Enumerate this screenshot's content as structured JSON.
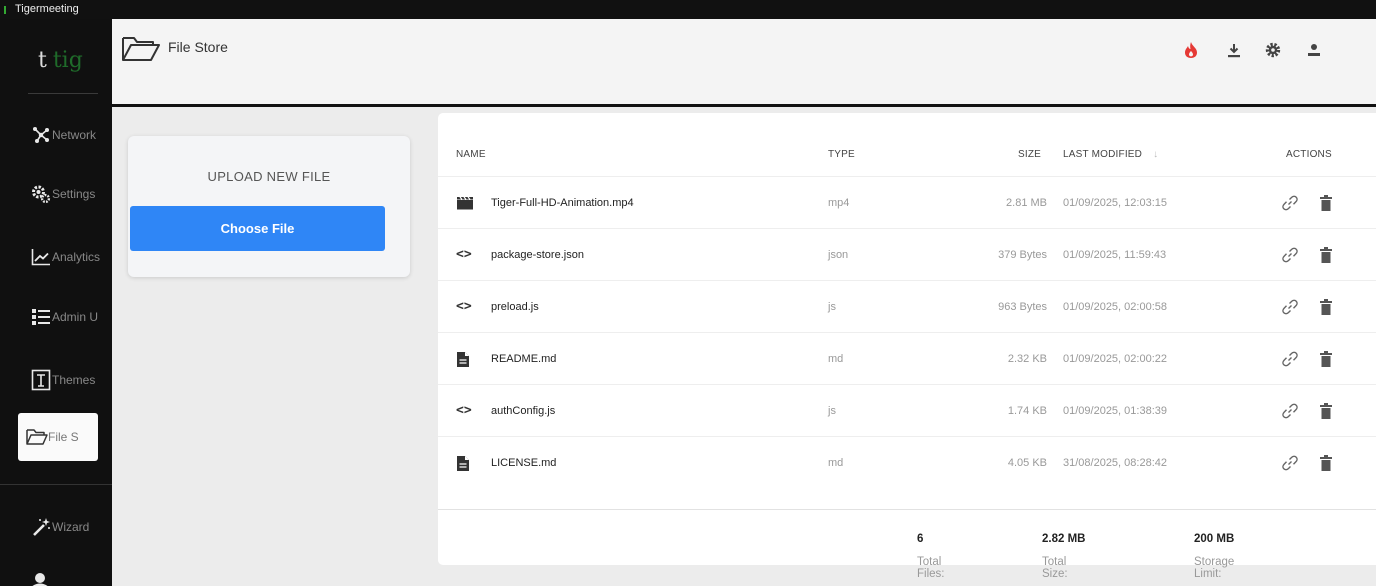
{
  "window": {
    "title": "Tigermeeting"
  },
  "sidebar": {
    "logo": {
      "prefix": "t",
      "accent": "tig"
    },
    "items": [
      {
        "label": "Network",
        "icon": "network-icon"
      },
      {
        "label": "Settings",
        "icon": "settings-icon"
      },
      {
        "label": "Analytics",
        "icon": "analytics-icon"
      },
      {
        "label": "Admin U",
        "icon": "admin-list-icon"
      },
      {
        "label": "Themes",
        "icon": "themes-icon"
      },
      {
        "label": "File S",
        "icon": "folder-icon",
        "active": true
      },
      {
        "label": "Wizard",
        "icon": "wizard-wand-icon"
      }
    ]
  },
  "header": {
    "title": "File Store",
    "icons": [
      "flame-icon",
      "download-icon",
      "gear-icon",
      "user-icon"
    ],
    "flame_color": "#e53935"
  },
  "upload": {
    "title": "UPLOAD NEW FILE",
    "button_label": "Choose File",
    "button_color": "#2f86f6"
  },
  "table": {
    "columns": {
      "name": "NAME",
      "type": "TYPE",
      "size": "SIZE",
      "modified": "LAST MODIFIED",
      "actions": "ACTIONS"
    },
    "sort_indicator": "↓",
    "rows": [
      {
        "icon": "video-icon",
        "name": "Tiger-Full-HD-Animation.mp4",
        "type": "mp4",
        "size": "2.81 MB",
        "modified": "01/09/2025, 12:03:15"
      },
      {
        "icon": "code-icon",
        "name": "package-store.json",
        "type": "json",
        "size": "379 Bytes",
        "modified": "01/09/2025, 11:59:43"
      },
      {
        "icon": "code-icon",
        "name": "preload.js",
        "type": "js",
        "size": "963 Bytes",
        "modified": "01/09/2025, 02:00:58"
      },
      {
        "icon": "document-icon",
        "name": "README.md",
        "type": "md",
        "size": "2.32 KB",
        "modified": "01/09/2025, 02:00:22"
      },
      {
        "icon": "code-icon",
        "name": "authConfig.js",
        "type": "js",
        "size": "1.74 KB",
        "modified": "01/09/2025, 01:38:39"
      },
      {
        "icon": "document-icon",
        "name": "LICENSE.md",
        "type": "md",
        "size": "4.05 KB",
        "modified": "31/08/2025, 08:28:42"
      }
    ]
  },
  "footer": {
    "total_files_label": "Total Files:",
    "total_files": "6",
    "total_size_label": "Total Size:",
    "total_size": "2.82 MB",
    "storage_limit_label": "Storage Limit:",
    "storage_limit": "200 MB"
  }
}
